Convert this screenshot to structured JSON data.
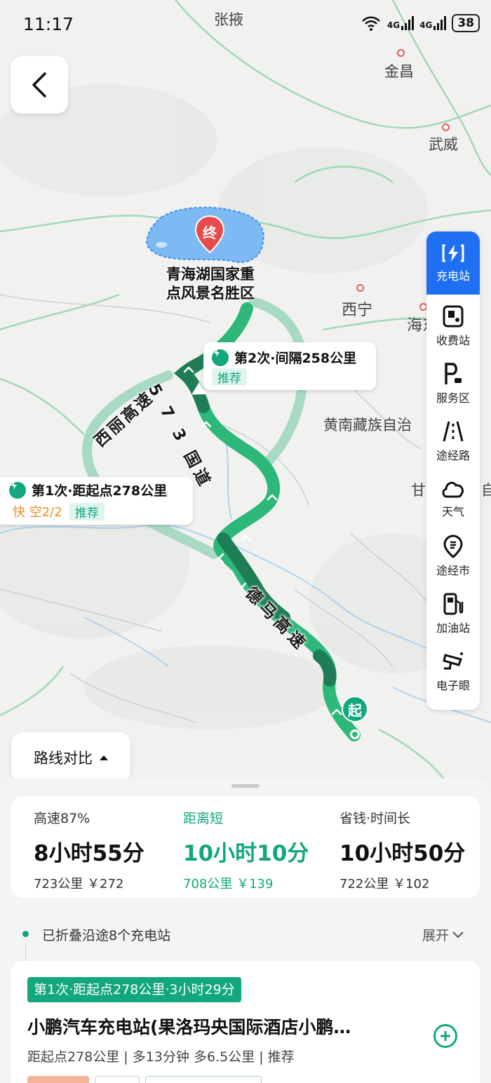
{
  "status": {
    "time": "11:17",
    "network1": "4G",
    "network2": "4G",
    "battery": "38"
  },
  "map": {
    "cities": [
      {
        "name": "张掖",
        "id": "zhangye"
      },
      {
        "name": "金昌",
        "id": "jinchang"
      },
      {
        "name": "武威",
        "id": "wuwei"
      },
      {
        "name": "西宁",
        "id": "xining"
      },
      {
        "name": "海东",
        "id": "haidong"
      },
      {
        "name": "黄南藏族自治",
        "id": "huangnan"
      },
      {
        "name": "甘",
        "id": "gan"
      },
      {
        "name": "自",
        "id": "zi"
      }
    ],
    "destination": {
      "marker": "终",
      "name_line1": "青海湖国家重",
      "name_line2": "点风景名胜区"
    },
    "origin_marker": "起",
    "roads": {
      "g573": "5 7 3 国道",
      "xili": "西丽高速",
      "dema": "德马高速"
    },
    "callout1": {
      "title": "第1次·距起点278公里",
      "fast": "快 空2/2",
      "tag": "推荐"
    },
    "callout2": {
      "title": "第2次·间隔258公里",
      "tag": "推荐"
    }
  },
  "toolbar": [
    {
      "id": "charging",
      "label": "充电站",
      "icon": "charging-icon",
      "active": true
    },
    {
      "id": "toll",
      "label": "收费站",
      "icon": "toll-icon"
    },
    {
      "id": "service",
      "label": "服务区",
      "icon": "parking-icon"
    },
    {
      "id": "via",
      "label": "途经路",
      "icon": "road-icon"
    },
    {
      "id": "weather",
      "label": "天气",
      "icon": "cloud-icon"
    },
    {
      "id": "city",
      "label": "途经市",
      "icon": "city-pin-icon"
    },
    {
      "id": "gas",
      "label": "加油站",
      "icon": "gas-icon"
    },
    {
      "id": "camera",
      "label": "电子眼",
      "icon": "camera-icon"
    }
  ],
  "compare_button": "路线对比",
  "routes": [
    {
      "tag": "高速87%",
      "time": "8小时55分",
      "meta": "723公里  ￥272"
    },
    {
      "tag": "距离短",
      "time": "10小时10分",
      "meta": "708公里  ￥139",
      "selected": true
    },
    {
      "tag": "省钱·时间长",
      "time": "10小时50分",
      "meta": "722公里  ￥102"
    }
  ],
  "collapsed": {
    "text": "已折叠沿途8个充电站",
    "expand": "展开"
  },
  "station": {
    "tag": "第1次·距起点278公里·3小时29分",
    "name": "小鹏汽车充电站(果洛玛央国际酒店小鹏…",
    "meta": "距起点278公里 | 多13分钟 多6.5公里 | 推荐"
  },
  "colors": {
    "accent": "#12a77c",
    "route_dark": "#1f8a5f",
    "route_mid": "#2db87a",
    "route_alt": "#9fd6c0",
    "active_blue": "#1f6ff2",
    "lake": "#7db9f2",
    "dest_pin": "#e84b4b"
  }
}
